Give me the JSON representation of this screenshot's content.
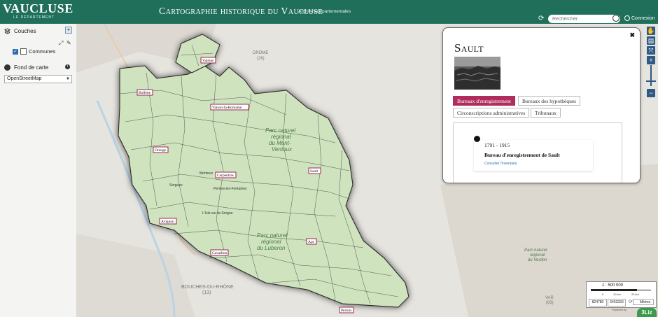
{
  "header": {
    "logo": "VAUCLUSE",
    "logo_sub": "LE DÉPARTEMENT",
    "title": "Cartographie historique du Vaucluse",
    "subtitle": "Archives départementales",
    "search_placeholder": "Rechercher",
    "login_label": "Connexion"
  },
  "sidebar": {
    "layers_title": "Couches",
    "layers": [
      {
        "label": "Communes",
        "checked": true
      }
    ],
    "basemap_title": "Fond de carte",
    "basemap_selected": "OpenStreetMap"
  },
  "map": {
    "place_labels": [
      {
        "text": "Valréas"
      },
      {
        "text": "Bollène"
      },
      {
        "text": "Vaison-la-Romaine"
      },
      {
        "text": "Orange"
      },
      {
        "text": "Carpentras"
      },
      {
        "text": "Sault"
      },
      {
        "text": "Avignon"
      },
      {
        "text": "Cavaillon"
      },
      {
        "text": "Apt"
      },
      {
        "text": "Pertuis"
      }
    ],
    "background_labels": [
      {
        "text": "DRÔME"
      },
      {
        "text": "(26)"
      },
      {
        "text": "Parc naturel"
      },
      {
        "text": "régional"
      },
      {
        "text": "du Mont-"
      },
      {
        "text": "Ventoux"
      },
      {
        "text": "Parc naturel"
      },
      {
        "text": "régional"
      },
      {
        "text": "du Luberon"
      },
      {
        "text": "BOUCHES-DU-RHÔNE"
      },
      {
        "text": "(13)"
      },
      {
        "text": "Parc naturel"
      },
      {
        "text": "régional"
      },
      {
        "text": "du Verdon"
      },
      {
        "text": "VAR"
      },
      {
        "text": "(83)"
      },
      {
        "text": "Monteux"
      },
      {
        "text": "Pernes-les-Fontaines"
      },
      {
        "text": "L'Isle-sur-la-Sorgue"
      },
      {
        "text": "Sorgues"
      }
    ],
    "tools": [
      "pan-tool",
      "layer-tool",
      "zoom-extent",
      "zoom-in",
      "zoom-out"
    ]
  },
  "popup": {
    "title": "Sault",
    "tabs": [
      {
        "label": "Bureaux d'enregistrement",
        "active": true
      },
      {
        "label": "Bureaux des hypothèques",
        "active": false
      },
      {
        "label": "Circonscriptions administratives",
        "active": false
      },
      {
        "label": "Tribunaux",
        "active": false
      }
    ],
    "record": {
      "years": "1791 - 1915",
      "title": "Bureau d'enregistrement de Sault",
      "link": "Consulter l'inventaire"
    }
  },
  "scale": {
    "ratio": "1 : 500 000",
    "ticks": [
      "0",
      "10 km",
      "20 km"
    ],
    "x": "824780",
    "y": "6453333",
    "unit": "Mètres"
  },
  "footer": {
    "powered": "Powered by",
    "brand": "3Liz"
  }
}
